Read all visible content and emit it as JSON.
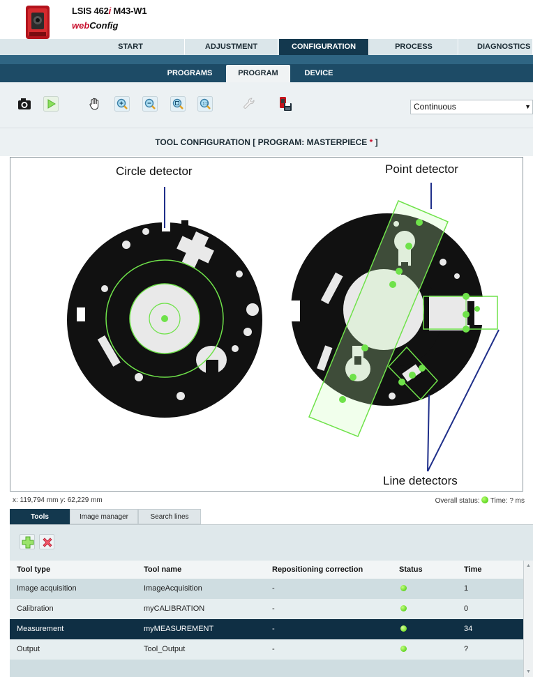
{
  "header": {
    "product_prefix": "LSIS 462",
    "product_ital": "i",
    "product_suffix": " M43-W1",
    "brand_web": "web",
    "brand_config": "Config"
  },
  "main_tabs": [
    {
      "label": "START"
    },
    {
      "label": "ADJUSTMENT"
    },
    {
      "label": "CONFIGURATION",
      "active": true
    },
    {
      "label": "PROCESS"
    },
    {
      "label": "DIAGNOSTICS"
    }
  ],
  "sub_tabs": [
    {
      "label": "PROGRAMS"
    },
    {
      "label": "PROGRAM",
      "active": true
    },
    {
      "label": "DEVICE"
    }
  ],
  "toolbar": {
    "icons": [
      "camera-icon",
      "play-icon",
      "hand-icon",
      "zoom-in-icon",
      "zoom-out-icon",
      "zoom-fit-icon",
      "zoom-reset-icon",
      "wrench-icon",
      "save-device-icon"
    ],
    "mode_select": "Continuous"
  },
  "title": {
    "prefix": "TOOL CONFIGURATION   [ PROGRAM: MASTERPIECE",
    "star": " *",
    "suffix": " ]"
  },
  "annotations": {
    "circle": "Circle detector",
    "point": "Point detector",
    "line": "Line detectors"
  },
  "coords": "x: 119,794 mm y: 62,229 mm",
  "overall_status": {
    "label": "Overall status:",
    "time": "Time: ? ms"
  },
  "bottom_tabs": [
    {
      "label": "Tools",
      "active": true
    },
    {
      "label": "Image manager"
    },
    {
      "label": "Search lines"
    }
  ],
  "panel_buttons": [
    "add-icon",
    "delete-icon"
  ],
  "table": {
    "headers": [
      "Tool type",
      "Tool name",
      "Repositioning correction",
      "Status",
      "Time"
    ],
    "rows": [
      {
        "type": "Image acquisition",
        "name": "ImageAcquisition",
        "correction": "-",
        "status": "ok",
        "time": "1"
      },
      {
        "type": "Calibration",
        "name": "myCALIBRATION",
        "correction": "-",
        "status": "ok",
        "time": "0"
      },
      {
        "type": "Measurement",
        "name": "myMEASUREMENT",
        "correction": "-",
        "status": "ok",
        "time": "34",
        "selected": true
      },
      {
        "type": "Output",
        "name": "Tool_Output",
        "correction": "-",
        "status": "ok",
        "time": "?"
      }
    ]
  },
  "colors": {
    "nav_dark": "#13384e",
    "sub_bar": "#1d4b66",
    "accent_red": "#c8102e",
    "detector_green": "#6fe24a",
    "status_green": "#36c400"
  }
}
